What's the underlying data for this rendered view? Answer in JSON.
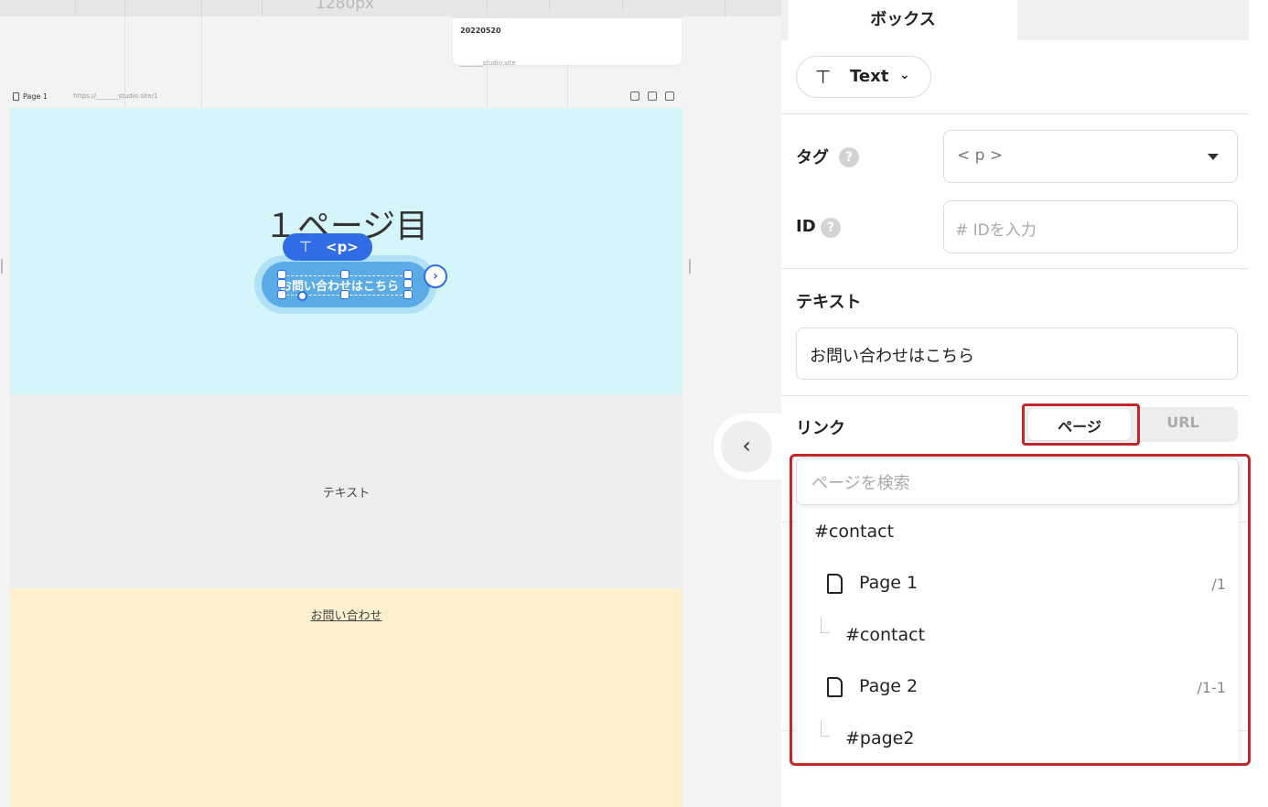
{
  "canvas": {
    "ruler_label": "1280px",
    "site_card": {
      "date": "20220520",
      "url": "_______studio.site"
    },
    "page_header": {
      "name": "Page 1",
      "url": "https://_______studio.site/1",
      "icons": [
        "trash-icon",
        "duplicate-icon",
        "add-page-icon"
      ]
    },
    "section1": {
      "heading": "１ページ目",
      "button_text": "お問い合わせはこちら",
      "background": "#d4f6fb"
    },
    "selection": {
      "tag_icon": "text-tool-icon",
      "tag_label": "<p>"
    },
    "section2": {
      "text": "テキスト",
      "background": "#eeeeee"
    },
    "section3": {
      "link_text": "お問い合わせ",
      "background": "#fcf0cf"
    }
  },
  "panel": {
    "tab_label": "ボックス",
    "element_type": {
      "icon": "text-tool-icon",
      "label": "Text"
    },
    "tag": {
      "label": "タグ",
      "value": "< p >"
    },
    "id": {
      "label": "ID",
      "placeholder": "#  IDを入力"
    },
    "text": {
      "label": "テキスト",
      "value": "お問い合わせはこちら"
    },
    "link": {
      "label": "リンク",
      "mode_options": [
        "ページ",
        "URL"
      ],
      "selected_mode": "ページ",
      "search_placeholder": "ページを検索",
      "items": [
        {
          "label": "#contact",
          "path": ""
        },
        {
          "label": "Page 1",
          "path": "/1"
        },
        {
          "label": "#contact",
          "path": ""
        },
        {
          "label": "Page 2",
          "path": "/1-1"
        },
        {
          "label": "#page2",
          "path": ""
        }
      ]
    }
  },
  "colors": {
    "accent": "#2f6ce5",
    "highlight": "#c0282a",
    "selected_button": "#5aabe6"
  }
}
